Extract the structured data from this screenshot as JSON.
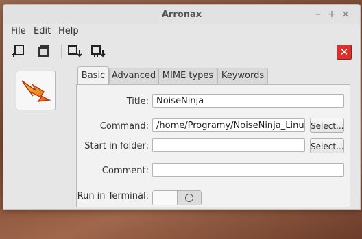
{
  "window": {
    "title": "Arronax"
  },
  "menu": [
    "File",
    "Edit",
    "Help"
  ],
  "toolbar": {
    "buttons": [
      "new-launcher-icon",
      "open-launcher-icon",
      "save-icon",
      "save-as-icon"
    ],
    "close_label": "✕",
    "close_color": "#d9302b"
  },
  "tabs": [
    "Basic",
    "Advanced",
    "MIME types",
    "Keywords"
  ],
  "form": {
    "title_label": "Title:",
    "title_value": "NoiseNinja",
    "command_label": "Command:",
    "command_value": "/home/Programy/NoiseNinja_Linux",
    "select_label": "Select...",
    "start_label": "Start in folder:",
    "start_value": "",
    "comment_label": "Comment:",
    "comment_value": "",
    "terminal_label": "Run in Terminal:",
    "terminal_on": false
  }
}
